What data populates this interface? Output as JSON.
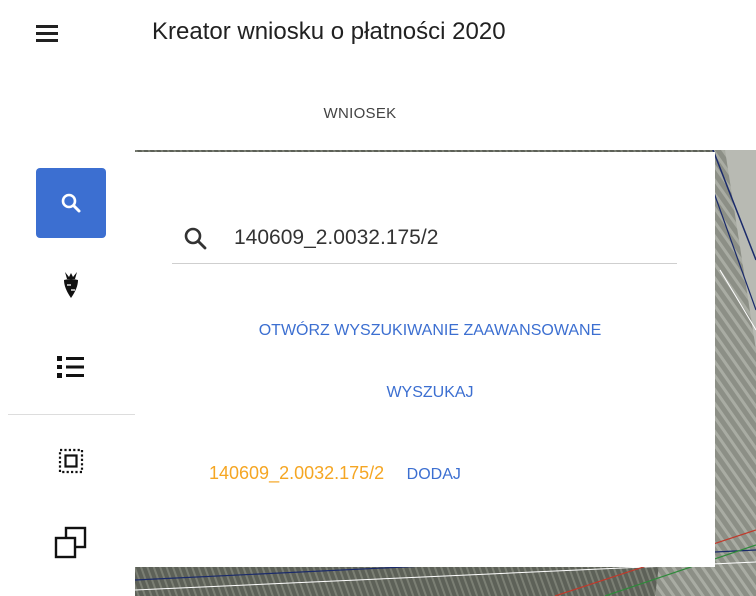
{
  "header": {
    "title": "Kreator wniosku o płatności 2020",
    "menu_icon": "hamburger-menu-icon"
  },
  "tabs": [
    {
      "label": "WNIOSEK"
    }
  ],
  "toolbar": {
    "tools": [
      {
        "icon": "search-icon",
        "active": true
      },
      {
        "icon": "beet-icon",
        "active": false
      },
      {
        "icon": "list-icon",
        "active": false
      },
      {
        "icon": "select-area-icon",
        "active": false
      },
      {
        "icon": "copy-icon",
        "active": false
      }
    ],
    "accent_color": "#3c6fd1"
  },
  "search_panel": {
    "query": "140609_2.0032.175/2",
    "advanced_search_label": "OTWÓRZ WYSZUKIWANIE ZAAWANSOWANE",
    "search_button_label": "WYSZUKAJ",
    "result": {
      "parcel_id": "140609_2.0032.175/2",
      "add_label": "DODAJ"
    },
    "result_color": "#f5a623"
  }
}
